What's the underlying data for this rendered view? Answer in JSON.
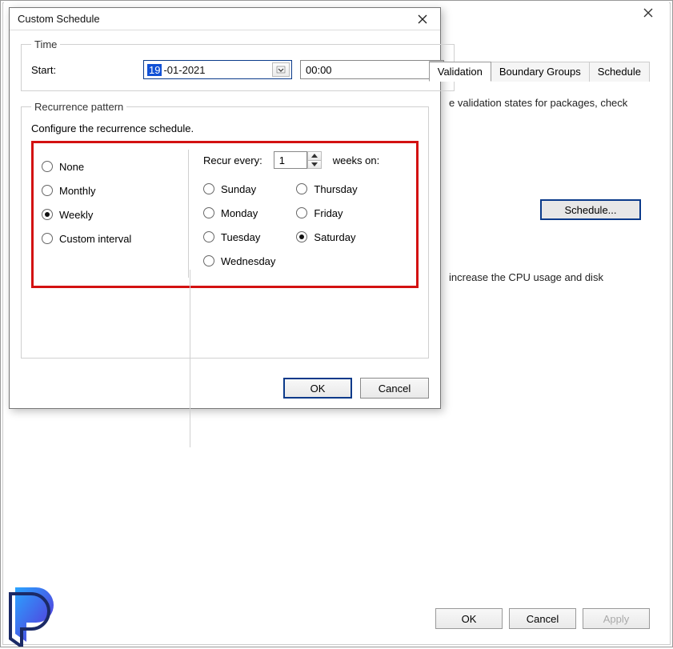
{
  "parent": {
    "tabs": [
      "Validation",
      "Boundary Groups",
      "Schedule"
    ],
    "active_tab": "Validation",
    "text1": "e validation states for packages, check",
    "schedule_button": "Schedule...",
    "text2": "increase the CPU usage and disk",
    "buttons": {
      "ok": "OK",
      "cancel": "Cancel",
      "apply": "Apply"
    }
  },
  "modal": {
    "title": "Custom Schedule",
    "time": {
      "legend": "Time",
      "start_label": "Start:",
      "date_selected": "19",
      "date_rest": "-01-2021",
      "time_value": "00:00"
    },
    "recurrence": {
      "legend": "Recurrence pattern",
      "desc": "Configure the recurrence schedule.",
      "options": {
        "none": "None",
        "monthly": "Monthly",
        "weekly": "Weekly",
        "custom": "Custom interval"
      },
      "selected": "weekly",
      "recur_label": "Recur every:",
      "recur_value": "1",
      "recur_suffix": "weeks on:",
      "days": {
        "sun": "Sunday",
        "mon": "Monday",
        "tue": "Tuesday",
        "wed": "Wednesday",
        "thu": "Thursday",
        "fri": "Friday",
        "sat": "Saturday"
      },
      "selected_day": "sat"
    },
    "buttons": {
      "ok": "OK",
      "cancel": "Cancel"
    }
  }
}
